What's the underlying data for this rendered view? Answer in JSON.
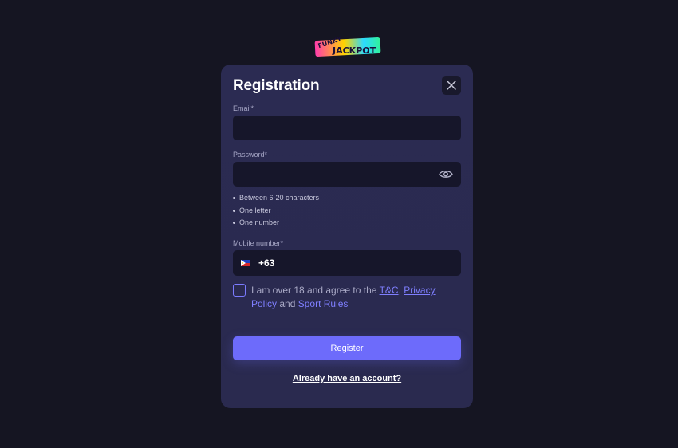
{
  "logo": {
    "line1": "FUNKY",
    "line2": "JACKPOT"
  },
  "modal": {
    "title": "Registration",
    "email": {
      "label": "Email*",
      "value": "",
      "placeholder": ""
    },
    "password": {
      "label": "Password*",
      "value": "",
      "placeholder": "",
      "rules": [
        "Between 6-20 characters",
        "One letter",
        "One number"
      ]
    },
    "mobile": {
      "label": "Mobile number*",
      "country_code": "+63",
      "flag": "philippines-flag"
    },
    "agreement": {
      "prefix": "I am over 18 and agree to the",
      "tc": "T&C",
      "sep": ",",
      "privacy": "Privacy Policy",
      "and": "and",
      "sport_rules": "Sport Rules",
      "checked": false
    },
    "register_label": "Register",
    "login_link": "Already have an account?"
  },
  "colors": {
    "background": "#151522",
    "modal": "#2b2b52",
    "input": "#16162a",
    "accent": "#6d6bfb",
    "link": "#7f7fff"
  },
  "icons": [
    "close-icon",
    "eye-icon",
    "philippines-flag-icon"
  ]
}
